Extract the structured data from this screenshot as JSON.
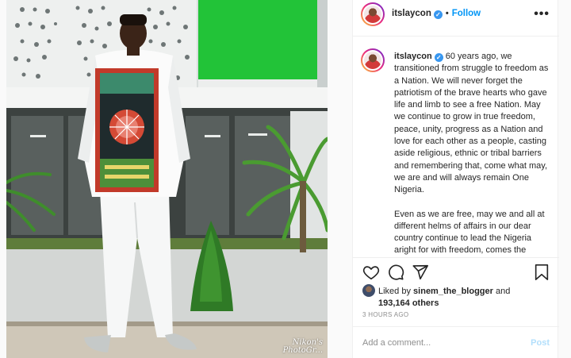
{
  "post": {
    "username": "itslaycon",
    "verified_icon": "verified-badge-icon",
    "separator": "•",
    "follow_label": "Follow",
    "more_icon": "more-options-icon",
    "more_glyph": "•••",
    "caption_paragraphs": [
      "60 years ago, we transitioned from struggle to freedom as a Nation. We will never forget the patriotism of the brave hearts who gave life and limb to see a free Nation. May we continue to grow in true freedom, peace, unity, progress as a Nation and love for each other as a people, casting aside religious, ethnic or tribal barriers and remembering that, come what may, we are and will always remain One Nigeria.",
      "Even as we are free, may we and all at different helms of affairs in our dear country continue to lead the Nigeria aright for with freedom, comes the responsibility of discipline and a need to herald the diversity that our dear Nigeria"
    ],
    "likes": {
      "prefix": "Liked by",
      "liker": "sinem_the_blogger",
      "and": "and",
      "others": "193,164 others"
    },
    "timestamp": "3 HOURS AGO",
    "comment_placeholder": "Add a comment...",
    "post_label": "Post"
  },
  "photo": {
    "watermark_line1": "Nikon's",
    "watermark_line2": "PhotoGr..."
  },
  "colors": {
    "accent": "#0095f6",
    "post_disabled": "#b2dffc",
    "muted": "#8e8e8e",
    "wall_green": "#22c338"
  },
  "icons": [
    "heart-icon",
    "comment-icon",
    "share-icon",
    "bookmark-icon"
  ]
}
